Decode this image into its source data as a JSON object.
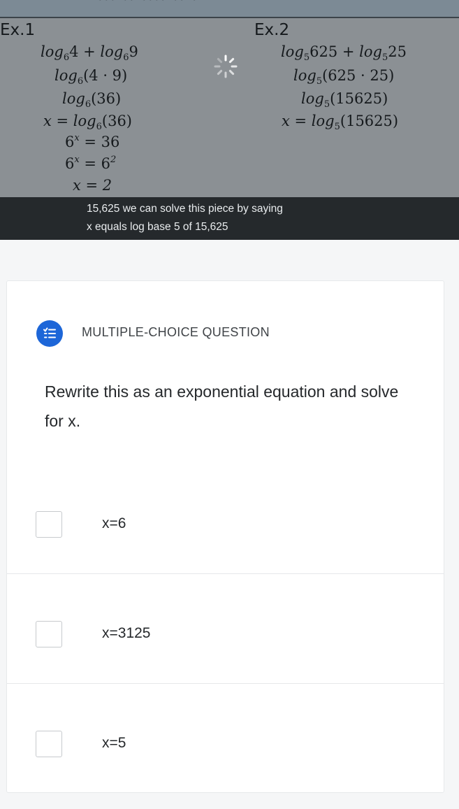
{
  "video": {
    "ex1": {
      "label": "Ex.1",
      "line1": {
        "a": "log",
        "b": "6",
        "c": "4 + ",
        "d": "log",
        "e": "6",
        "f": "9"
      },
      "line2": {
        "a": "log",
        "b": "6",
        "c": "(4 · 9)"
      },
      "line3": {
        "a": "log",
        "b": "6",
        "c": "(36)"
      },
      "line4": {
        "a": "x = ",
        "b": "log",
        "c": "6",
        "d": "(36)"
      },
      "line5": {
        "a": "6",
        "b": "x",
        "c": " = 36"
      },
      "line6": {
        "a": "6",
        "b": "x",
        "c": " = 6",
        "d": "2"
      },
      "line7": {
        "a": "x = 2"
      }
    },
    "ex2": {
      "label": "Ex.2",
      "line1": {
        "a": "log",
        "b": "5",
        "c": "625 + ",
        "d": "log",
        "e": "5",
        "f": "25"
      },
      "line2": {
        "a": "log",
        "b": "5",
        "c": "(625 · 25)"
      },
      "line3": {
        "a": "log",
        "b": "5",
        "c": "(15625)"
      },
      "line4": {
        "a": "x = ",
        "b": "log",
        "c": "5",
        "d": "(15625)"
      }
    },
    "caption": {
      "line1": "15,625 we can solve this piece by saying",
      "line2": "x equals log base 5 of 15,625"
    },
    "spinner_icon": "loading-spinner-icon"
  },
  "question": {
    "type_label": "MULTIPLE-CHOICE QUESTION",
    "type_icon": "list-check-icon",
    "accent_color": "#1d66d8",
    "text": "Rewrite this as an exponential equation and solve for x.",
    "options": [
      {
        "label": "x=6"
      },
      {
        "label": "x=3125"
      },
      {
        "label": "x=5"
      }
    ]
  }
}
